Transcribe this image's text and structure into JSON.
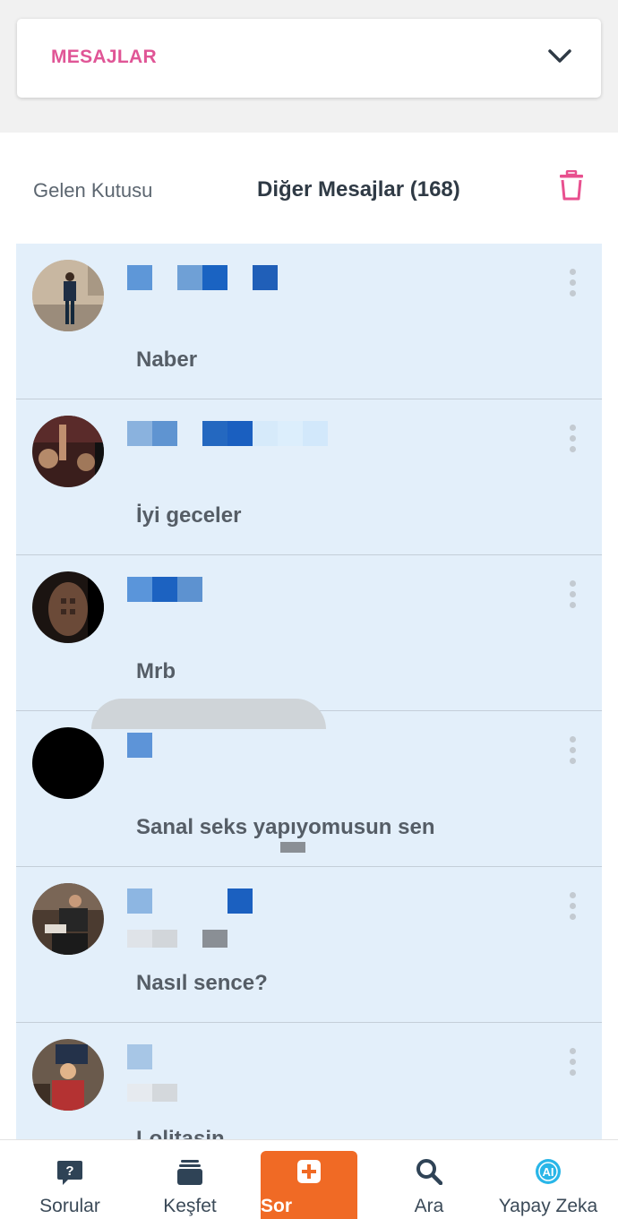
{
  "dropdown": {
    "title": "MESAJLAR",
    "chevron_icon": "chevron-down-icon"
  },
  "tabs": {
    "inbox": "Gelen Kutusu",
    "other": "Diğer Mesajlar (168)",
    "delete_icon": "trash-icon"
  },
  "colors": {
    "accent_pink": "#e05596",
    "list_bg": "#e3effa",
    "sor_orange": "#f06a25"
  },
  "messages": [
    {
      "preview": "Naber"
    },
    {
      "preview": "İyi geceler"
    },
    {
      "preview": "Mrb"
    },
    {
      "preview": "Sanal seks yapıyomusun sen"
    },
    {
      "preview": "Nasıl sence?"
    },
    {
      "preview": "Lolitasin"
    }
  ],
  "nav": {
    "items": [
      {
        "label": "Sorular",
        "icon": "question-icon"
      },
      {
        "label": "Keşfet",
        "icon": "cards-icon"
      },
      {
        "label": "Sor",
        "icon": "plus-icon"
      },
      {
        "label": "Ara",
        "icon": "search-icon"
      },
      {
        "label": "Yapay Zeka",
        "icon": "ai-icon"
      }
    ]
  }
}
